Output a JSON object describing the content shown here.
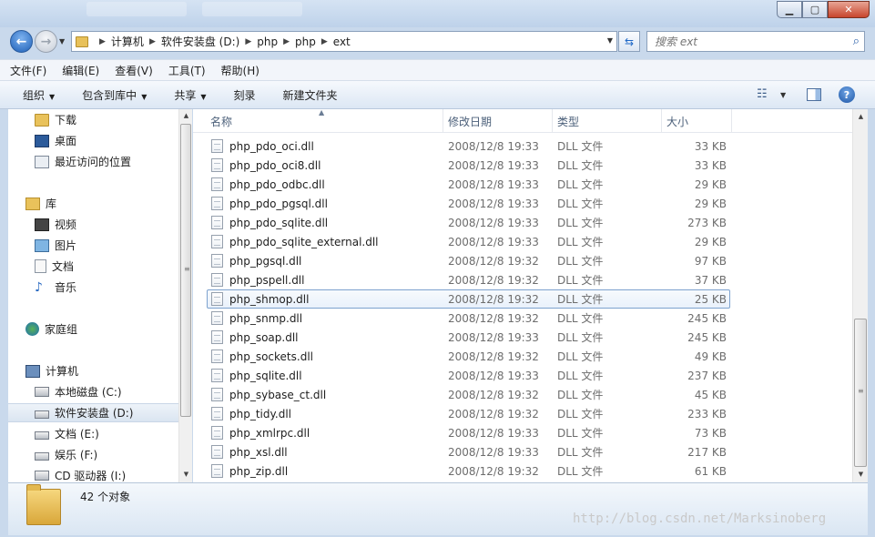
{
  "window": {
    "min_glyph": "▁",
    "max_glyph": "▢",
    "close_glyph": "✕"
  },
  "address": {
    "crumbs": [
      "计算机",
      "软件安装盘 (D:)",
      "php",
      "php",
      "ext"
    ]
  },
  "search": {
    "placeholder": "搜索 ext"
  },
  "menu": [
    "文件(F)",
    "编辑(E)",
    "查看(V)",
    "工具(T)",
    "帮助(H)"
  ],
  "commands": {
    "organize": "组织",
    "include_library": "包含到库中",
    "share": "共享",
    "burn": "刻录",
    "new_folder": "新建文件夹"
  },
  "nav": {
    "favorites": [
      "下载",
      "桌面",
      "最近访问的位置"
    ],
    "library_label": "库",
    "libraries": [
      "视频",
      "图片",
      "文档",
      "音乐"
    ],
    "homegroup": "家庭组",
    "computer_label": "计算机",
    "drives": [
      "本地磁盘 (C:)",
      "软件安装盘 (D:)",
      "文档 (E:)",
      "娱乐 (F:)",
      "CD 驱动器 (I:)"
    ],
    "selected_drive": "软件安装盘 (D:)"
  },
  "columns": {
    "name": "名称",
    "date": "修改日期",
    "type": "类型",
    "size": "大小"
  },
  "files": [
    {
      "name": "php_pdo_oci.dll",
      "date": "2008/12/8 19:33",
      "type": "DLL 文件",
      "size": "33 KB"
    },
    {
      "name": "php_pdo_oci8.dll",
      "date": "2008/12/8 19:33",
      "type": "DLL 文件",
      "size": "33 KB"
    },
    {
      "name": "php_pdo_odbc.dll",
      "date": "2008/12/8 19:33",
      "type": "DLL 文件",
      "size": "29 KB"
    },
    {
      "name": "php_pdo_pgsql.dll",
      "date": "2008/12/8 19:33",
      "type": "DLL 文件",
      "size": "29 KB"
    },
    {
      "name": "php_pdo_sqlite.dll",
      "date": "2008/12/8 19:33",
      "type": "DLL 文件",
      "size": "273 KB"
    },
    {
      "name": "php_pdo_sqlite_external.dll",
      "date": "2008/12/8 19:33",
      "type": "DLL 文件",
      "size": "29 KB"
    },
    {
      "name": "php_pgsql.dll",
      "date": "2008/12/8 19:32",
      "type": "DLL 文件",
      "size": "97 KB"
    },
    {
      "name": "php_pspell.dll",
      "date": "2008/12/8 19:32",
      "type": "DLL 文件",
      "size": "37 KB"
    },
    {
      "name": "php_shmop.dll",
      "date": "2008/12/8 19:32",
      "type": "DLL 文件",
      "size": "25 KB",
      "selected": true
    },
    {
      "name": "php_snmp.dll",
      "date": "2008/12/8 19:32",
      "type": "DLL 文件",
      "size": "245 KB"
    },
    {
      "name": "php_soap.dll",
      "date": "2008/12/8 19:33",
      "type": "DLL 文件",
      "size": "245 KB"
    },
    {
      "name": "php_sockets.dll",
      "date": "2008/12/8 19:32",
      "type": "DLL 文件",
      "size": "49 KB"
    },
    {
      "name": "php_sqlite.dll",
      "date": "2008/12/8 19:33",
      "type": "DLL 文件",
      "size": "237 KB"
    },
    {
      "name": "php_sybase_ct.dll",
      "date": "2008/12/8 19:32",
      "type": "DLL 文件",
      "size": "45 KB"
    },
    {
      "name": "php_tidy.dll",
      "date": "2008/12/8 19:32",
      "type": "DLL 文件",
      "size": "233 KB"
    },
    {
      "name": "php_xmlrpc.dll",
      "date": "2008/12/8 19:33",
      "type": "DLL 文件",
      "size": "73 KB"
    },
    {
      "name": "php_xsl.dll",
      "date": "2008/12/8 19:33",
      "type": "DLL 文件",
      "size": "217 KB"
    },
    {
      "name": "php_zip.dll",
      "date": "2008/12/8 19:32",
      "type": "DLL 文件",
      "size": "61 KB"
    }
  ],
  "status": {
    "item_count": "42 个对象"
  },
  "watermark": "http://blog.csdn.net/Marksinoberg",
  "colors": {
    "selection_border": "#7da2ce",
    "chrome": "#c9d9ec"
  }
}
